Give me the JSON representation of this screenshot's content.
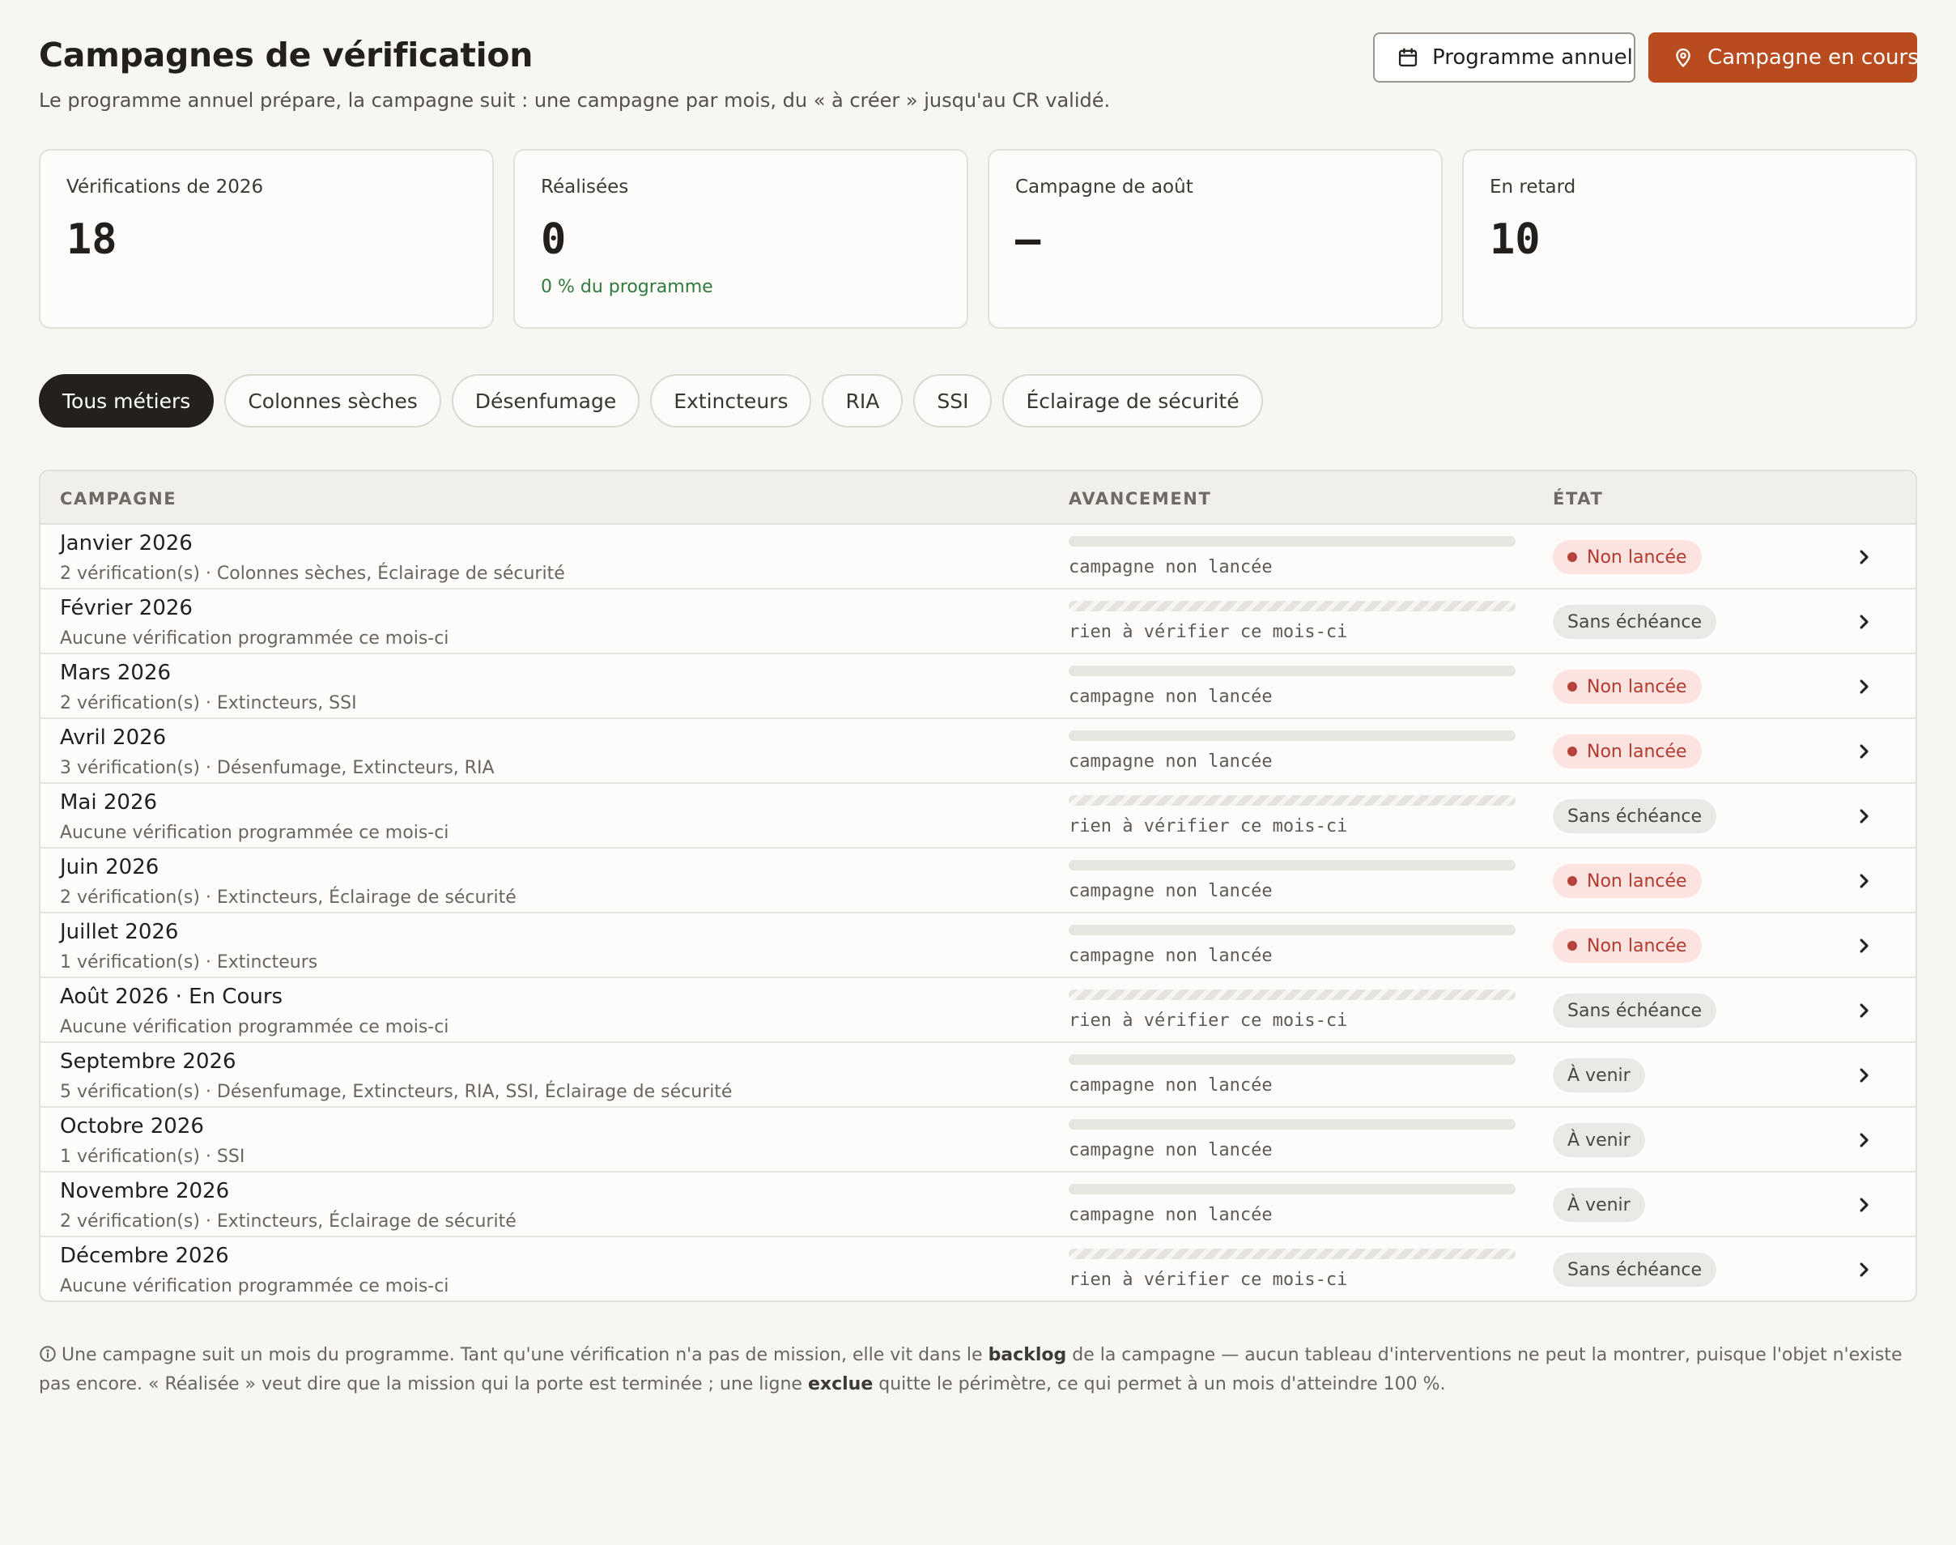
{
  "header": {
    "title": "Campagnes de vérification",
    "subtitle": "Le programme annuel prépare, la campagne suit : une campagne par mois, du « à créer » jusqu'au CR validé.",
    "btn_programme": "Programme annuel",
    "btn_campagne": "Campagne en cours",
    "btn_programme_icon": "calendar-icon",
    "btn_campagne_icon": "map-pin-icon"
  },
  "stats": [
    {
      "label": "Vérifications de 2026",
      "value": "18",
      "sub": ""
    },
    {
      "label": "Réalisées",
      "value": "0",
      "sub": "0 % du programme"
    },
    {
      "label": "Campagne de août",
      "value": "—",
      "sub": ""
    },
    {
      "label": "En retard",
      "value": "10",
      "sub": ""
    }
  ],
  "filters": {
    "active": "Tous métiers",
    "chips": [
      "Tous métiers",
      "Colonnes sèches",
      "Désenfumage",
      "Extincteurs",
      "RIA",
      "SSI",
      "Éclairage de sécurité"
    ]
  },
  "table": {
    "headers": {
      "campagne": "CAMPAGNE",
      "avancement": "AVANCEMENT",
      "etat": "ÉTAT"
    },
    "rows": [
      {
        "title": "Janvier 2026",
        "desc": "2 vérification(s) · Colonnes sèches, Éclairage de sécurité",
        "progress_text": "campagne non lancée",
        "progress": 0,
        "striped": false,
        "status": "Non lancée",
        "status_type": "red"
      },
      {
        "title": "Février 2026",
        "desc": "Aucune vérification programmée ce mois-ci",
        "progress_text": "rien à vérifier ce mois-ci",
        "progress": 0,
        "striped": true,
        "status": "Sans échéance",
        "status_type": "grey"
      },
      {
        "title": "Mars 2026",
        "desc": "2 vérification(s) · Extincteurs, SSI",
        "progress_text": "campagne non lancée",
        "progress": 0,
        "striped": false,
        "status": "Non lancée",
        "status_type": "red"
      },
      {
        "title": "Avril 2026",
        "desc": "3 vérification(s) · Désenfumage, Extincteurs, RIA",
        "progress_text": "campagne non lancée",
        "progress": 0,
        "striped": false,
        "status": "Non lancée",
        "status_type": "red"
      },
      {
        "title": "Mai 2026",
        "desc": "Aucune vérification programmée ce mois-ci",
        "progress_text": "rien à vérifier ce mois-ci",
        "progress": 0,
        "striped": true,
        "status": "Sans échéance",
        "status_type": "grey"
      },
      {
        "title": "Juin 2026",
        "desc": "2 vérification(s) · Extincteurs, Éclairage de sécurité",
        "progress_text": "campagne non lancée",
        "progress": 0,
        "striped": false,
        "status": "Non lancée",
        "status_type": "red"
      },
      {
        "title": "Juillet 2026",
        "desc": "1 vérification(s) · Extincteurs",
        "progress_text": "campagne non lancée",
        "progress": 0,
        "striped": false,
        "status": "Non lancée",
        "status_type": "red"
      },
      {
        "title": "Août 2026 · En Cours",
        "desc": "Aucune vérification programmée ce mois-ci",
        "progress_text": "rien à vérifier ce mois-ci",
        "progress": 0,
        "striped": true,
        "status": "Sans échéance",
        "status_type": "grey"
      },
      {
        "title": "Septembre 2026",
        "desc": "5 vérification(s) · Désenfumage, Extincteurs, RIA, SSI, Éclairage de sécurité",
        "progress_text": "campagne non lancée",
        "progress": 0,
        "striped": false,
        "status": "À venir",
        "status_type": "grey"
      },
      {
        "title": "Octobre 2026",
        "desc": "1 vérification(s) · SSI",
        "progress_text": "campagne non lancée",
        "progress": 0,
        "striped": false,
        "status": "À venir",
        "status_type": "grey"
      },
      {
        "title": "Novembre 2026",
        "desc": "2 vérification(s) · Extincteurs, Éclairage de sécurité",
        "progress_text": "campagne non lancée",
        "progress": 0,
        "striped": false,
        "status": "À venir",
        "status_type": "grey"
      },
      {
        "title": "Décembre 2026",
        "desc": "Aucune vérification programmée ce mois-ci",
        "progress_text": "rien à vérifier ce mois-ci",
        "progress": 0,
        "striped": true,
        "status": "Sans échéance",
        "status_type": "grey"
      }
    ]
  },
  "footnote": {
    "part1": "Une campagne suit un mois du programme. Tant qu'une vérification n'a pas de mission, elle vit dans le ",
    "bold1": "backlog",
    "part2": " de la campagne — aucun tableau d'interventions ne peut la montrer, puisque l'objet n'existe pas encore. « Réalisée » veut dire que la mission qui la porte est terminée ; une ligne ",
    "bold2": "exclue",
    "part3": " quitte le périmètre, ce qui permet à un mois d'atteindre 100 %."
  },
  "colors": {
    "accent": "#b84c1f",
    "active_chip": "#24201c",
    "success": "#2f7a3c",
    "danger_bg": "#fbe3e0",
    "danger_text": "#b23a30"
  }
}
